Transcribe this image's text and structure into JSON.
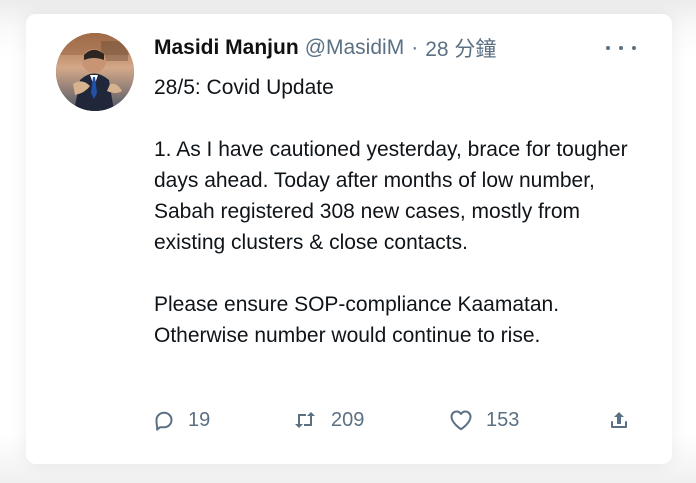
{
  "tweet": {
    "author_name": "Masidi Manjun",
    "handle": "@MasidiM",
    "separator": "·",
    "time": "28 分鐘",
    "title": "28/5: Covid Update",
    "paragraph_1": "1. As I have cautioned yesterday, brace for tougher days ahead. Today after months of low number, Sabah registered 308 new cases, mostly from existing clusters & close contacts.",
    "paragraph_2": "Please ensure SOP-compliance Kaamatan. Otherwise number would continue to rise."
  },
  "actions": {
    "reply_count": "19",
    "retweet_count": "209",
    "like_count": "153"
  },
  "icons": {
    "avatar": "profile-photo",
    "more": "more-icon",
    "reply": "reply-icon",
    "retweet": "retweet-icon",
    "like": "heart-icon",
    "share": "share-icon"
  },
  "colors": {
    "text_primary": "#0f1419",
    "text_secondary": "#5b7083",
    "card_background": "#ffffff"
  }
}
